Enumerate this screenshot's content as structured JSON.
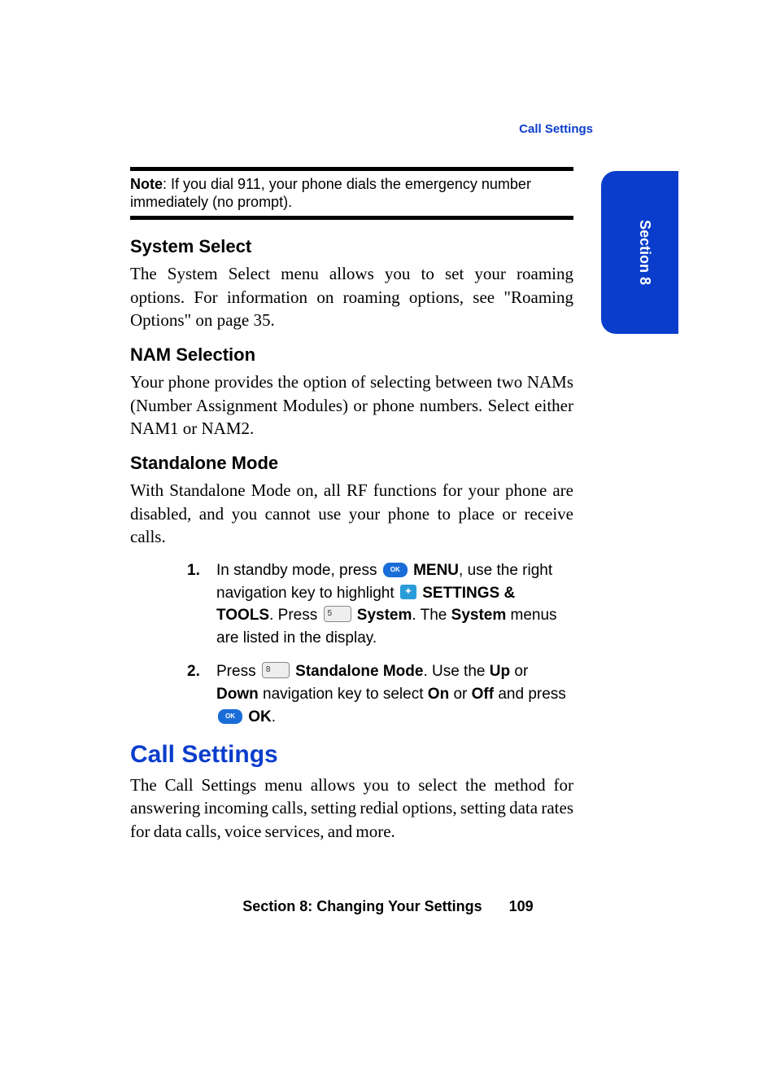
{
  "runningHead": "Call Settings",
  "sideTab": "Section 8",
  "note": {
    "label": "Note",
    "text": ": If you dial 911, your phone dials the emergency number immediately (no prompt)."
  },
  "systemSelect": {
    "heading": "System Select",
    "body": "The System Select menu allows you to set your roaming options. For information on roaming options, see \"Roaming Options\" on page 35."
  },
  "namSelection": {
    "heading": "NAM Selection",
    "body": "Your phone provides the option of selecting between two NAMs (Number Assignment Modules) or phone numbers. Select either NAM1 or NAM2."
  },
  "standalone": {
    "heading": "Standalone Mode",
    "body": "With Standalone Mode on, all RF functions for your phone are disabled, and you cannot use your phone to place or receive calls."
  },
  "steps": {
    "s1": {
      "num": "1.",
      "p1a": "In standby mode, press ",
      "p1_menu": "MENU",
      "p1b": ", use the right navigation key to highlight ",
      "p1_settings": "SETTINGS & TOOLS",
      "p1c": ". Press ",
      "p1_system": "System",
      "p1d": ". The ",
      "p1_system2": "System",
      "p1e": " menus are listed in the display."
    },
    "s2": {
      "num": "2.",
      "p2a": "Press ",
      "p2_sm": "Standalone Mode",
      "p2b": ". Use the ",
      "p2_up": "Up",
      "p2c": " or ",
      "p2_down": "Down",
      "p2d": " navigation key to select ",
      "p2_on": "On",
      "p2e": " or ",
      "p2_off": "Off",
      "p2f": " and press ",
      "p2_ok": "OK",
      "p2g": "."
    }
  },
  "callSettings": {
    "heading": "Call Settings",
    "body": "The Call Settings menu allows you to select the method for answering incoming calls, setting redial options, setting data rates for data calls, voice services, and more."
  },
  "footer": {
    "title": "Section 8: Changing Your Settings",
    "page": "109"
  }
}
